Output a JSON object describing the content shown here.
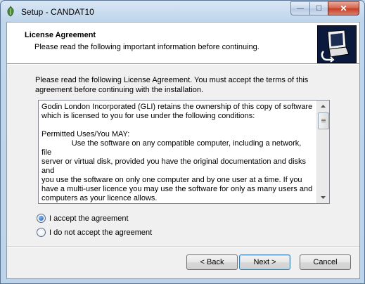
{
  "window": {
    "title": "Setup - CANDAT10",
    "buttons": {
      "minimize": "—",
      "maximize": "☐",
      "close": "✕"
    }
  },
  "header": {
    "title": "License Agreement",
    "subtitle": "Please read the following important information before continuing."
  },
  "intro": "Please read the following License Agreement. You must accept the terms of this agreement before continuing with the installation.",
  "license": {
    "text": "Godin London Incorporated (GLI) retains the ownership of this copy of software\nwhich is licensed to you for use under the following conditions:\n\nPermitted Uses/You MAY:\n              Use the software on any compatible computer, including a network, file\nserver or virtual disk, provided you have the original documentation and disks and\nyou use the software on only one computer and by one user at a time. If you\nhave a multi-user licence you may use the software for only as many users and\ncomputers as your licence allows.\n\nProhibited Uses/You MAY NOT:"
  },
  "options": {
    "accept": "I accept the agreement",
    "decline": "I do not accept the agreement",
    "selected": "accept"
  },
  "footer": {
    "back": "< Back",
    "next": "Next >",
    "cancel": "Cancel"
  }
}
